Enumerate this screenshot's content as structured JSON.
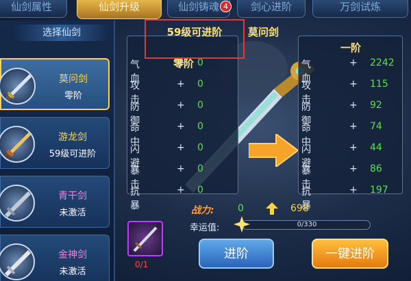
{
  "tabs": [
    {
      "label": "仙剑属性"
    },
    {
      "label": "仙剑升级"
    },
    {
      "label": "仙剑铸魂"
    },
    {
      "label": "剑心进阶"
    },
    {
      "label": "万剑试炼"
    }
  ],
  "tab_badge": "4",
  "left": {
    "title": "选择仙剑",
    "swords": [
      {
        "name": "莫问剑",
        "status": "零阶",
        "name_color": "#ffd84a"
      },
      {
        "name": "游龙剑",
        "status": "59级可进阶",
        "name_color": "#ffd84a"
      },
      {
        "name": "青干剑",
        "status": "未激活",
        "name_color": "#ff7ad9"
      },
      {
        "name": "金神剑",
        "status": "未激活",
        "name_color": "#ff7ad9"
      }
    ]
  },
  "current": {
    "requirement": "59级可进阶",
    "stage": "零阶",
    "sword_name": "莫问剑",
    "stats": [
      {
        "label": "气血",
        "value": "0"
      },
      {
        "label": "攻击",
        "value": "0"
      },
      {
        "label": "防御",
        "value": "0"
      },
      {
        "label": "命中",
        "value": "0"
      },
      {
        "label": "闪避",
        "value": "0"
      },
      {
        "label": "暴击",
        "value": "0"
      },
      {
        "label": "抗暴",
        "value": "0"
      }
    ]
  },
  "next": {
    "stage": "一阶",
    "stats": [
      {
        "label": "气血",
        "value": "2242"
      },
      {
        "label": "攻击",
        "value": "115"
      },
      {
        "label": "防御",
        "value": "92"
      },
      {
        "label": "命中",
        "value": "74"
      },
      {
        "label": "闪避",
        "value": "44"
      },
      {
        "label": "暴击",
        "value": "86"
      },
      {
        "label": "抗暴",
        "value": "197"
      }
    ]
  },
  "plus_sign": "+",
  "power": {
    "label": "战力:",
    "current": "0",
    "next": "698"
  },
  "luck": {
    "label": "幸运值:",
    "text": "0/330",
    "fraction": 0.0
  },
  "material": {
    "count": "0/1"
  },
  "buttons": {
    "advance": "进阶",
    "one_key": "一键进阶"
  },
  "colors": {
    "accent_gold": "#ffd24a",
    "stat_green": "#5be24a",
    "power_orange": "#ff9a3a"
  }
}
